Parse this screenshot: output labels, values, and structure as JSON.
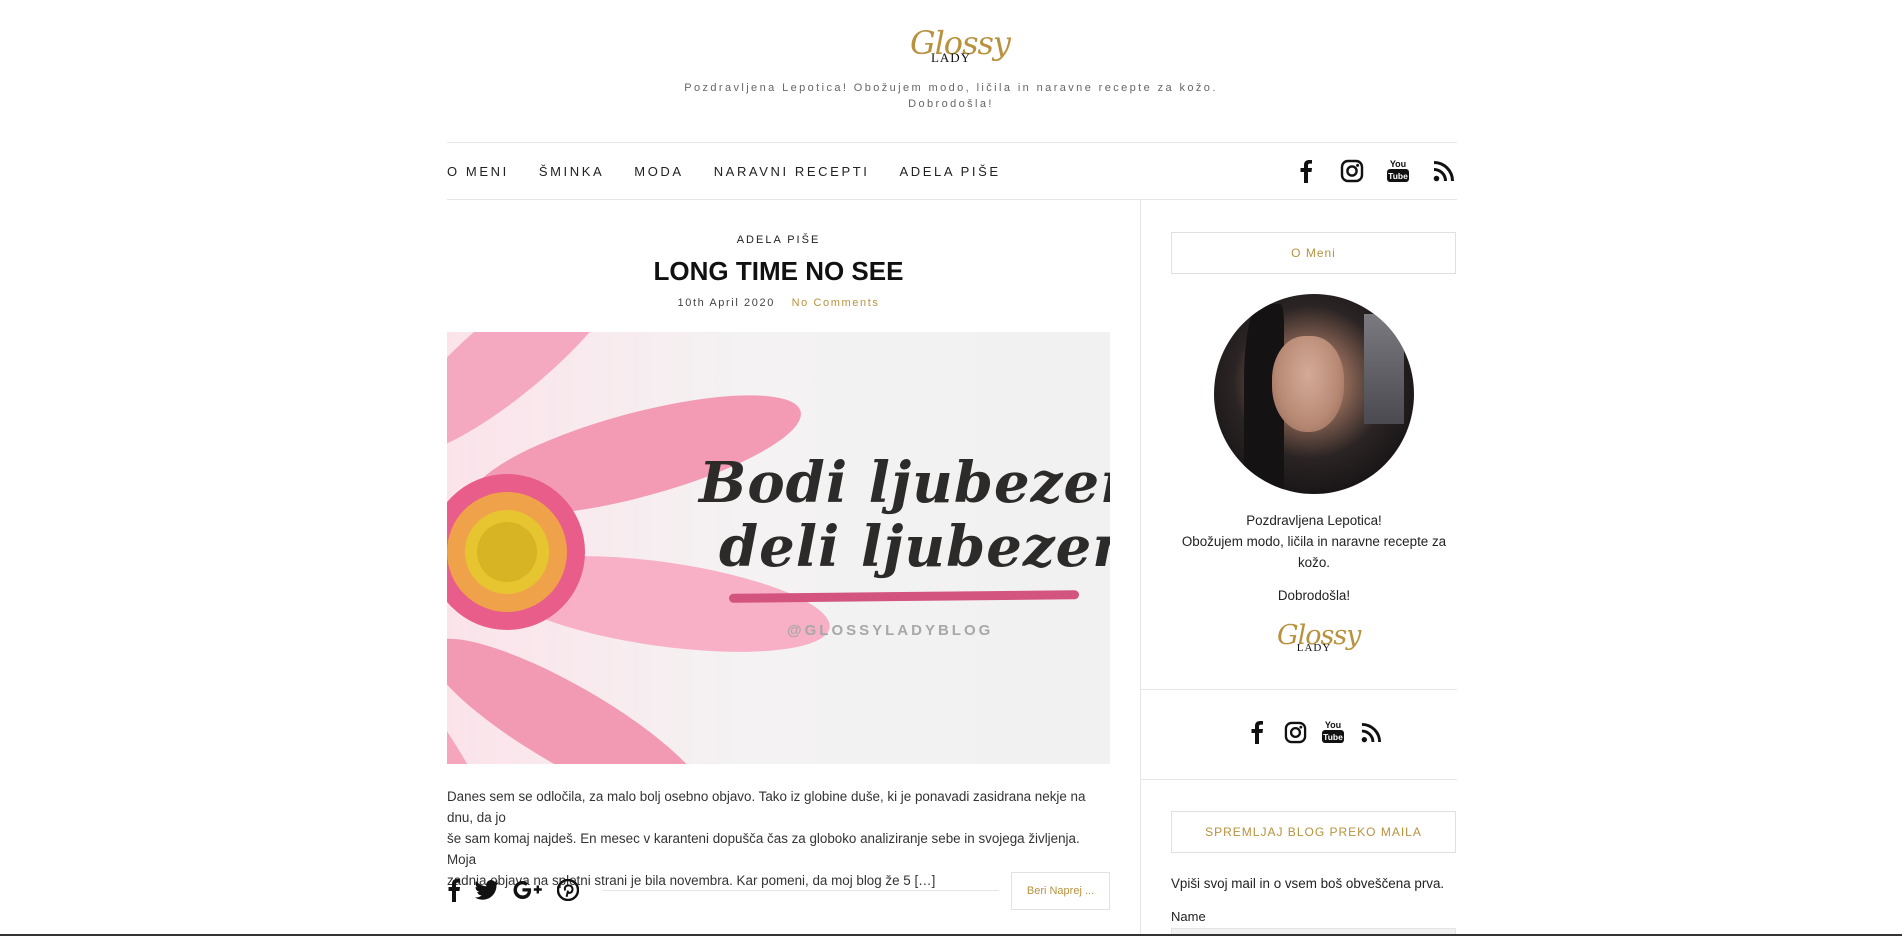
{
  "header": {
    "logo_script": "Glossy",
    "logo_sub": "LADY",
    "tagline_line1": "Pozdravljena Lepotica! Obožujem modo, ličila in naravne recepte za kožo.",
    "tagline_line2": "Dobrodošla!"
  },
  "nav": {
    "items": [
      {
        "label": "O MENI"
      },
      {
        "label": "ŠMINKA"
      },
      {
        "label": "MODA"
      },
      {
        "label": "NARAVNI RECEPTI"
      },
      {
        "label": "ADELA PIŠE"
      }
    ],
    "social_icons": [
      "facebook-icon",
      "instagram-icon",
      "youtube-icon",
      "rss-icon"
    ]
  },
  "post": {
    "category": "ADELA PIŠE",
    "title": "LONG TIME NO SEE",
    "date": "10th April 2020",
    "comments": "No Comments",
    "image": {
      "line1": "Bodi ljubezen,",
      "line2": "deli ljubezen",
      "handle": "@GLOSSYLADYBLOG"
    },
    "excerpt_line1": "Danes sem se odločila, za malo bolj osebno objavo. Tako iz globine duše, ki je ponavadi zasidrana nekje na dnu, da jo",
    "excerpt_line2": "še sam komaj najdeš. En mesec v karanteni dopušča čas za globoko analiziranje sebe in svojega življenja. Moja",
    "excerpt_line3": "zadnja objava na spletni strani je bila novembra. Kar pomeni, da moj blog že 5 […]",
    "share_icons": [
      "facebook-icon",
      "twitter-icon",
      "google-plus-icon",
      "pinterest-icon"
    ],
    "read_more": "Beri Naprej ..."
  },
  "sidebar": {
    "about_title": "O Meni",
    "about_line1": "Pozdravljena Lepotica!",
    "about_line2": "Obožujem modo, ličila in naravne recepte za",
    "about_line3": "kožo.",
    "about_welcome": "Dobrodošla!",
    "logo_script": "Glossy",
    "logo_sub": "LADY",
    "social_icons": [
      "facebook-icon",
      "instagram-icon",
      "youtube-icon",
      "rss-icon"
    ],
    "subscribe_title": "SPREMLJAJ BLOG PREKO MAILA",
    "subscribe_text": "Vpiši svoj mail in o vsem boš obveščena prva.",
    "name_label": "Name"
  },
  "youtube_label": {
    "you": "You",
    "tube": "Tube"
  },
  "colors": {
    "accent": "#b8923e",
    "text": "#222222",
    "divider": "#e6e6e6",
    "highlight": "#d3557f"
  }
}
